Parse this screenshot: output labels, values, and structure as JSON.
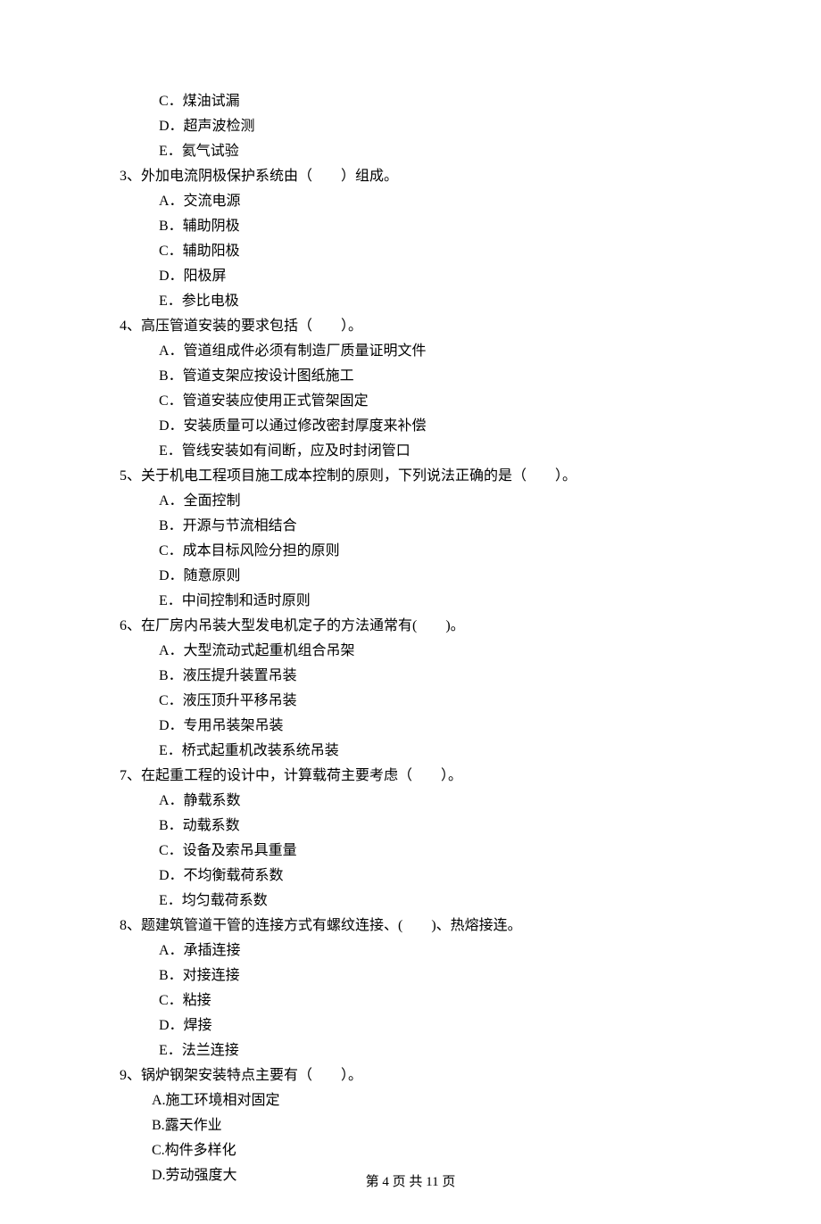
{
  "prelude_options": [
    "C．煤油试漏",
    "D．超声波检测",
    "E．氦气试验"
  ],
  "questions": [
    {
      "num": "3、",
      "text": "外加电流阴极保护系统由（　　）组成。",
      "options": [
        "A．交流电源",
        "B．辅助阴极",
        "C．辅助阳极",
        "D．阳极屏",
        "E．参比电极"
      ]
    },
    {
      "num": "4、",
      "text": "高压管道安装的要求包括（　　）。",
      "options": [
        "A．管道组成件必须有制造厂质量证明文件",
        "B．管道支架应按设计图纸施工",
        "C．管道安装应使用正式管架固定",
        "D．安装质量可以通过修改密封厚度来补偿",
        "E．管线安装如有间断，应及时封闭管口"
      ]
    },
    {
      "num": "5、",
      "text": "关于机电工程项目施工成本控制的原则，下列说法正确的是（　　）。",
      "options": [
        "A．全面控制",
        "B．开源与节流相结合",
        "C．成本目标风险分担的原则",
        "D．随意原则",
        "E．中间控制和适时原则"
      ]
    },
    {
      "num": "6、",
      "text": "在厂房内吊装大型发电机定子的方法通常有(　　)。",
      "options": [
        "A．大型流动式起重机组合吊架",
        "B．液压提升装置吊装",
        "C．液压顶升平移吊装",
        "D．专用吊装架吊装",
        "E．桥式起重机改装系统吊装"
      ]
    },
    {
      "num": "7、",
      "text": "在起重工程的设计中，计算载荷主要考虑（　　）。",
      "options": [
        "A．静载系数",
        "B．动载系数",
        "C．设备及索吊具重量",
        "D．不均衡载荷系数",
        "E．均匀载荷系数"
      ]
    },
    {
      "num": "8、",
      "text": "题建筑管道干管的连接方式有螺纹连接、(　　)、热熔接连。",
      "options": [
        "A．承插连接",
        "B．对接连接",
        "C．粘接",
        "D．焊接",
        "E．法兰连接"
      ]
    },
    {
      "num": "9、",
      "text": "锅炉钢架安装特点主要有（　　）。",
      "options": [
        "A.施工环境相对固定",
        "B.露天作业",
        "C.构件多样化",
        "D.劳动强度大"
      ]
    }
  ],
  "footer": "第 4 页 共 11 页"
}
